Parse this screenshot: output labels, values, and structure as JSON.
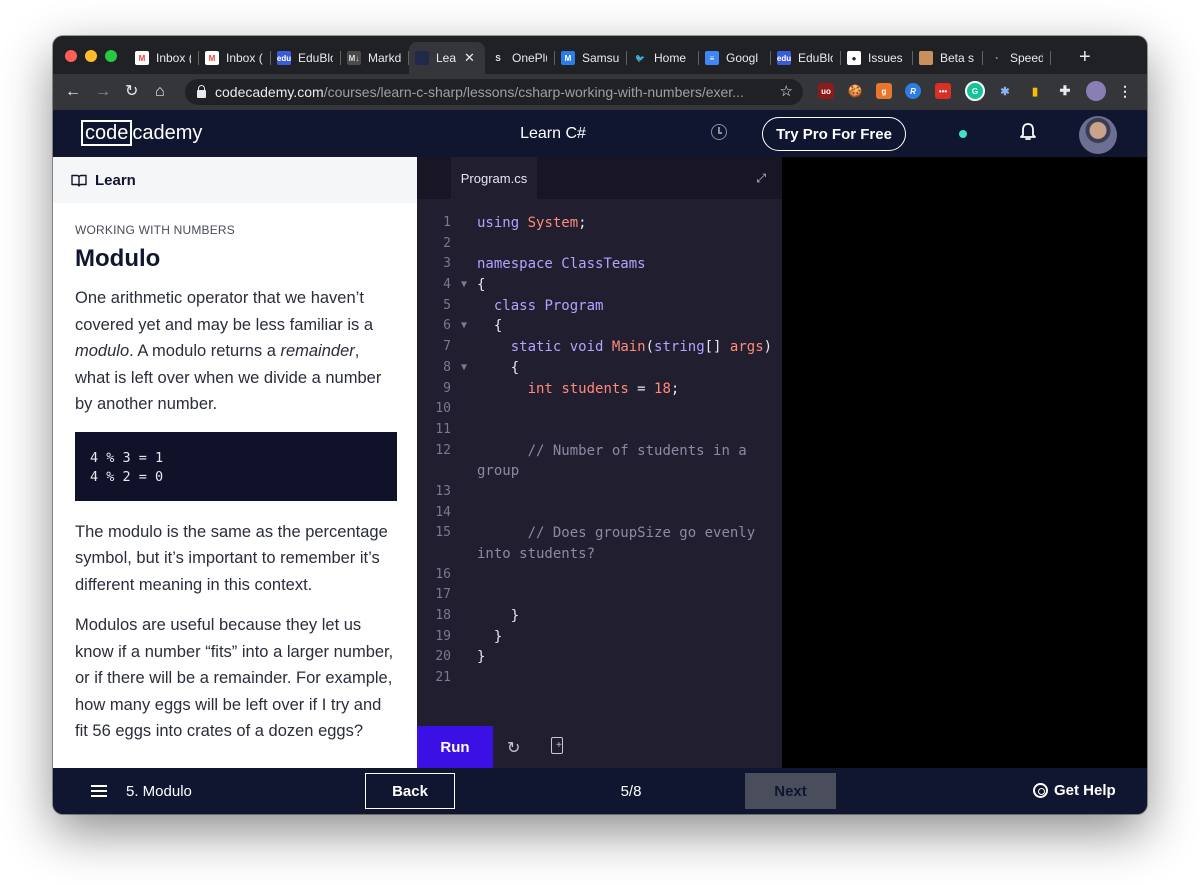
{
  "browser": {
    "tabs": [
      {
        "label": "Inbox (",
        "icon": "gmail-icon",
        "color": "#ffffff",
        "text": "M",
        "fg": "#ea4335"
      },
      {
        "label": "Inbox (",
        "icon": "gmail-icon",
        "color": "#ffffff",
        "text": "M",
        "fg": "#ea4335"
      },
      {
        "label": "EduBlo",
        "icon": "edublocks-icon",
        "color": "#3b5bdb",
        "text": "edu",
        "fg": "#ffffff"
      },
      {
        "label": "Markdo",
        "icon": "markdown-icon",
        "color": "#4a4a4a",
        "text": "M↓",
        "fg": "#dddddd"
      },
      {
        "label": "Lea",
        "icon": "codecademy-tab-icon",
        "color": "#1f2a4a",
        "text": "",
        "fg": "#ffffff",
        "active": true
      },
      {
        "label": "OnePlu",
        "icon": "oneplus-icon",
        "color": "#202124",
        "text": "S",
        "fg": "#e8eaed"
      },
      {
        "label": "Samsu",
        "icon": "samsung-icon",
        "color": "#2b7de9",
        "text": "M",
        "fg": "#ffffff"
      },
      {
        "label": "Home",
        "icon": "twitter-icon",
        "color": "#202124",
        "text": "🐦",
        "fg": "#1da1f2"
      },
      {
        "label": "Googl",
        "icon": "google-docs-icon",
        "color": "#4285f4",
        "text": "≡",
        "fg": "#ffffff"
      },
      {
        "label": "EduBlo",
        "icon": "edublocks-icon",
        "color": "#3b5bdb",
        "text": "edu",
        "fg": "#ffffff"
      },
      {
        "label": "Issues",
        "icon": "github-icon",
        "color": "#ffffff",
        "text": "●",
        "fg": "#202124"
      },
      {
        "label": "Beta s",
        "icon": "beta-avatar-icon",
        "color": "#c98f5c",
        "text": "",
        "fg": "#ffffff"
      },
      {
        "label": "Speed",
        "icon": "speedtest-icon",
        "color": "#202124",
        "text": "◔",
        "fg": "#9aa0a6"
      }
    ],
    "url_host": "codecademy.com",
    "url_path": "/courses/learn-c-sharp/lessons/csharp-working-with-numbers/exer..."
  },
  "header": {
    "logo_boxed": "code",
    "logo_rest": "cademy",
    "course_title": "Learn C#",
    "try_pro_label": "Try Pro For Free"
  },
  "lesson": {
    "panel_label": "Learn",
    "eyebrow": "WORKING WITH NUMBERS",
    "title": "Modulo",
    "p1_a": "One arithmetic operator that we haven’t covered yet and may be less familiar is a ",
    "p1_em1": "modulo",
    "p1_b": ". A modulo returns a ",
    "p1_em2": "remainder",
    "p1_c": ", what is left over when we divide a number by another number.",
    "code_example": "4 % 3 = 1\n4 % 2 = 0",
    "p2": "The modulo is the same as the percentage symbol, but it’s important to remember it’s different meaning in this context.",
    "p3": "Modulos are useful because they let us know if a number “fits” into a larger number, or if there will be a remainder. For example, how many eggs will be left over if I try and fit 56 eggs into crates of a dozen eggs?"
  },
  "editor": {
    "file_name": "Program.cs",
    "run_label": "Run",
    "lines": [
      {
        "n": "1",
        "fold": "",
        "html": "<span class=\"kw\">using</span> <span class=\"ty\">System</span>;"
      },
      {
        "n": "2",
        "fold": "",
        "html": ""
      },
      {
        "n": "3",
        "fold": "",
        "html": "<span class=\"kw\">namespace</span> <span class=\"kw\">ClassTeams</span>"
      },
      {
        "n": "4",
        "fold": "▼",
        "html": "{"
      },
      {
        "n": "5",
        "fold": "",
        "html": "  <span class=\"kw\">class</span> <span class=\"kw\">Program</span>"
      },
      {
        "n": "6",
        "fold": "▼",
        "html": "  {"
      },
      {
        "n": "7",
        "fold": "",
        "html": "    <span class=\"kw\">static</span> <span class=\"kw\">void</span> <span class=\"ty\">Main</span>(<span class=\"kw\">string</span>[] <span class=\"ty\">args</span>)"
      },
      {
        "n": "8",
        "fold": "▼",
        "html": "    {"
      },
      {
        "n": "9",
        "fold": "",
        "html": "      <span class=\"ty\">int</span> <span class=\"ty\">students</span> = <span class=\"nm\">18</span>;"
      },
      {
        "n": "10",
        "fold": "",
        "html": ""
      },
      {
        "n": "11",
        "fold": "",
        "html": ""
      },
      {
        "n": "12",
        "fold": "",
        "html": "      <span class=\"cm\">// Number of students in a</span>",
        "wrap": "group"
      },
      {
        "n": "13",
        "fold": "",
        "html": ""
      },
      {
        "n": "14",
        "fold": "",
        "html": ""
      },
      {
        "n": "15",
        "fold": "",
        "html": "      <span class=\"cm\">// Does groupSize go evenly</span>",
        "wrap": "into students?"
      },
      {
        "n": "16",
        "fold": "",
        "html": ""
      },
      {
        "n": "17",
        "fold": "",
        "html": ""
      },
      {
        "n": "18",
        "fold": "",
        "html": "    }"
      },
      {
        "n": "19",
        "fold": "",
        "html": "  }"
      },
      {
        "n": "20",
        "fold": "",
        "html": "}"
      },
      {
        "n": "21",
        "fold": "",
        "html": ""
      }
    ]
  },
  "footer": {
    "lesson_name": "5. Modulo",
    "back_label": "Back",
    "progress": "5/8",
    "next_label": "Next",
    "help_label": "Get Help"
  },
  "colors": {
    "navy": "#10162f",
    "editor_bg": "#211e2f",
    "run_button": "#3a10e5",
    "status_dot": "#3ee2c4"
  }
}
